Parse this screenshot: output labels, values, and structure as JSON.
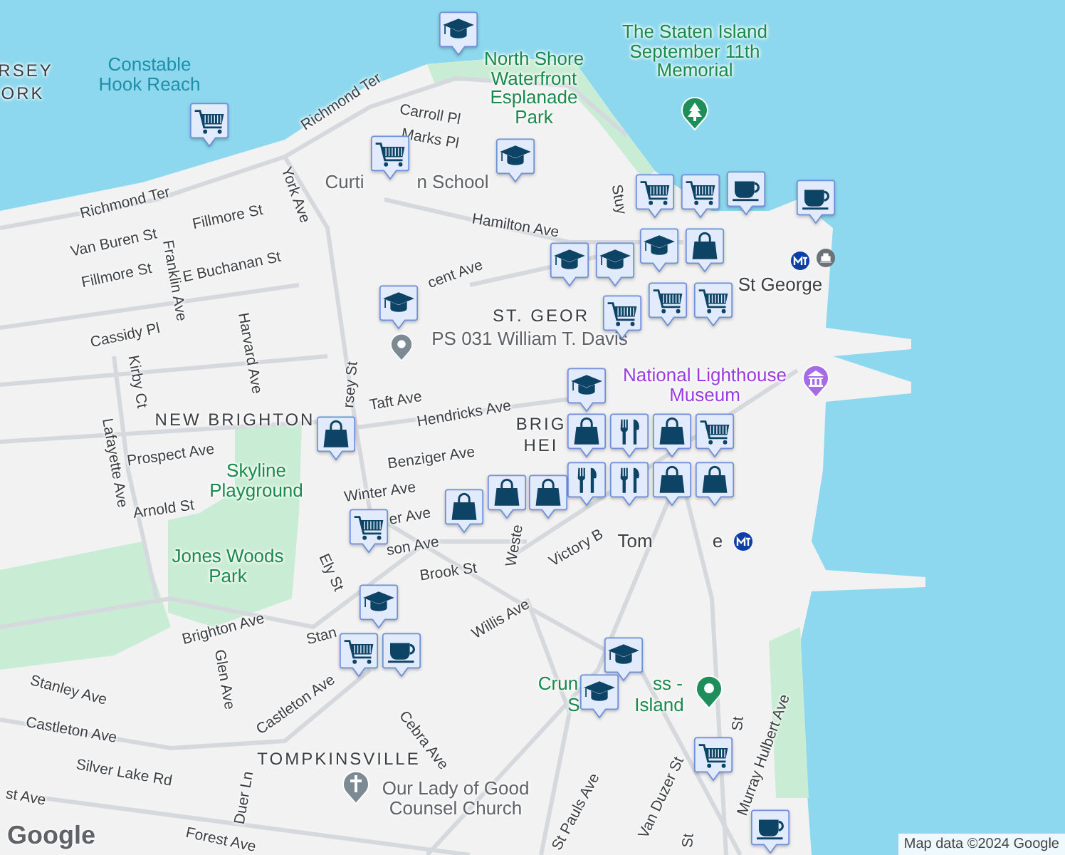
{
  "map": {
    "labels": [
      {
        "text": "RSEY",
        "kind": "area"
      },
      {
        "text": "ORK",
        "kind": "area"
      },
      {
        "text": "Constable Hook Reach",
        "kind": "water"
      },
      {
        "text": "North Shore Waterfront Esplanade Park",
        "kind": "park"
      },
      {
        "text": "The Staten Island September 11th Memorial",
        "kind": "park"
      },
      {
        "text": "Richmond Ter",
        "kind": "street"
      },
      {
        "text": "Richmond Ter",
        "kind": "street"
      },
      {
        "text": "Carroll Pl",
        "kind": "street"
      },
      {
        "text": "Marks Pl",
        "kind": "street"
      },
      {
        "text": "Curti",
        "kind": "poi"
      },
      {
        "text": "n School",
        "kind": "poi"
      },
      {
        "text": "Hamilton Ave",
        "kind": "street"
      },
      {
        "text": "Stuy",
        "kind": "street"
      },
      {
        "text": "Van Buren St",
        "kind": "street"
      },
      {
        "text": "Fillmore St",
        "kind": "street"
      },
      {
        "text": "Fillmore St",
        "kind": "street"
      },
      {
        "text": "E Buchanan St",
        "kind": "street"
      },
      {
        "text": "Franklin Ave",
        "kind": "street"
      },
      {
        "text": "York Ave",
        "kind": "street"
      },
      {
        "text": "cent Ave",
        "kind": "street"
      },
      {
        "text": "St George",
        "kind": "station"
      },
      {
        "text": "ST. GEOR",
        "kind": "area"
      },
      {
        "text": "PS 031 William T. Davis",
        "kind": "poi"
      },
      {
        "text": "Cassidy Pl",
        "kind": "street"
      },
      {
        "text": "Harvard Ave",
        "kind": "street"
      },
      {
        "text": "Kirby Ct",
        "kind": "street"
      },
      {
        "text": "National Lighthouse Museum",
        "kind": "museum"
      },
      {
        "text": "rsey St",
        "kind": "street"
      },
      {
        "text": "Taft Ave",
        "kind": "street"
      },
      {
        "text": "Hendricks Ave",
        "kind": "street"
      },
      {
        "text": "NEW BRIGHTON",
        "kind": "area"
      },
      {
        "text": "BRIG",
        "kind": "area"
      },
      {
        "text": "HEI",
        "kind": "area"
      },
      {
        "text": "Lafayette Ave",
        "kind": "street"
      },
      {
        "text": "Prospect Ave",
        "kind": "street"
      },
      {
        "text": "Skyline Playground",
        "kind": "park"
      },
      {
        "text": "Benziger Ave",
        "kind": "street"
      },
      {
        "text": "Arnold St",
        "kind": "street"
      },
      {
        "text": "Winter Ave",
        "kind": "street"
      },
      {
        "text": "er Ave",
        "kind": "street"
      },
      {
        "text": "son Ave",
        "kind": "street"
      },
      {
        "text": "Weste",
        "kind": "street"
      },
      {
        "text": "Victory B",
        "kind": "street"
      },
      {
        "text": "Tom",
        "kind": "station"
      },
      {
        "text": "e",
        "kind": "station"
      },
      {
        "text": "Jones Woods Park",
        "kind": "park"
      },
      {
        "text": "Ely St",
        "kind": "street"
      },
      {
        "text": "Brook St",
        "kind": "street"
      },
      {
        "text": "Willis Ave",
        "kind": "street"
      },
      {
        "text": "Brighton Ave",
        "kind": "street"
      },
      {
        "text": "Stan",
        "kind": "street"
      },
      {
        "text": "Glen Ave",
        "kind": "street"
      },
      {
        "text": "Crun",
        "kind": "park"
      },
      {
        "text": "ss -",
        "kind": "park"
      },
      {
        "text": "S",
        "kind": "park"
      },
      {
        "text": "Island",
        "kind": "park"
      },
      {
        "text": "Stanley Ave",
        "kind": "street"
      },
      {
        "text": "Castleton Ave",
        "kind": "street"
      },
      {
        "text": "Castleton Ave",
        "kind": "street"
      },
      {
        "text": "Cebra Ave",
        "kind": "street"
      },
      {
        "text": "Murray Hulbert Ave",
        "kind": "street"
      },
      {
        "text": "St",
        "kind": "street"
      },
      {
        "text": "TOMPKINSVILLE",
        "kind": "area"
      },
      {
        "text": "Silver Lake Rd",
        "kind": "street"
      },
      {
        "text": "Our Lady of Good Counsel Church",
        "kind": "poi"
      },
      {
        "text": "st Ave",
        "kind": "street"
      },
      {
        "text": "Duer Ln",
        "kind": "street"
      },
      {
        "text": "St Pauls Ave",
        "kind": "street"
      },
      {
        "text": "Van Duzer St",
        "kind": "street"
      },
      {
        "text": "St",
        "kind": "street"
      },
      {
        "text": "Forest Ave",
        "kind": "street"
      }
    ],
    "pins": [
      {
        "kind": "school"
      },
      {
        "kind": "grocery"
      },
      {
        "kind": "grocery"
      },
      {
        "kind": "school"
      },
      {
        "kind": "grocery"
      },
      {
        "kind": "grocery"
      },
      {
        "kind": "cafe"
      },
      {
        "kind": "cafe"
      },
      {
        "kind": "school"
      },
      {
        "kind": "school"
      },
      {
        "kind": "school"
      },
      {
        "kind": "shop"
      },
      {
        "kind": "grocery"
      },
      {
        "kind": "grocery"
      },
      {
        "kind": "grocery"
      },
      {
        "kind": "school"
      },
      {
        "kind": "school"
      },
      {
        "kind": "shop"
      },
      {
        "kind": "shop"
      },
      {
        "kind": "restaurant"
      },
      {
        "kind": "restaurant"
      },
      {
        "kind": "grocery"
      },
      {
        "kind": "shop"
      },
      {
        "kind": "shop"
      },
      {
        "kind": "grocery"
      },
      {
        "kind": "shop"
      },
      {
        "kind": "shop"
      },
      {
        "kind": "restaurant"
      },
      {
        "kind": "shop"
      },
      {
        "kind": "shop"
      },
      {
        "kind": "school"
      },
      {
        "kind": "grocery"
      },
      {
        "kind": "cafe"
      },
      {
        "kind": "school"
      },
      {
        "kind": "school"
      },
      {
        "kind": "grocery"
      },
      {
        "kind": "cafe"
      }
    ],
    "logo": "Google",
    "attribution": "Map data ©2024 Google"
  }
}
